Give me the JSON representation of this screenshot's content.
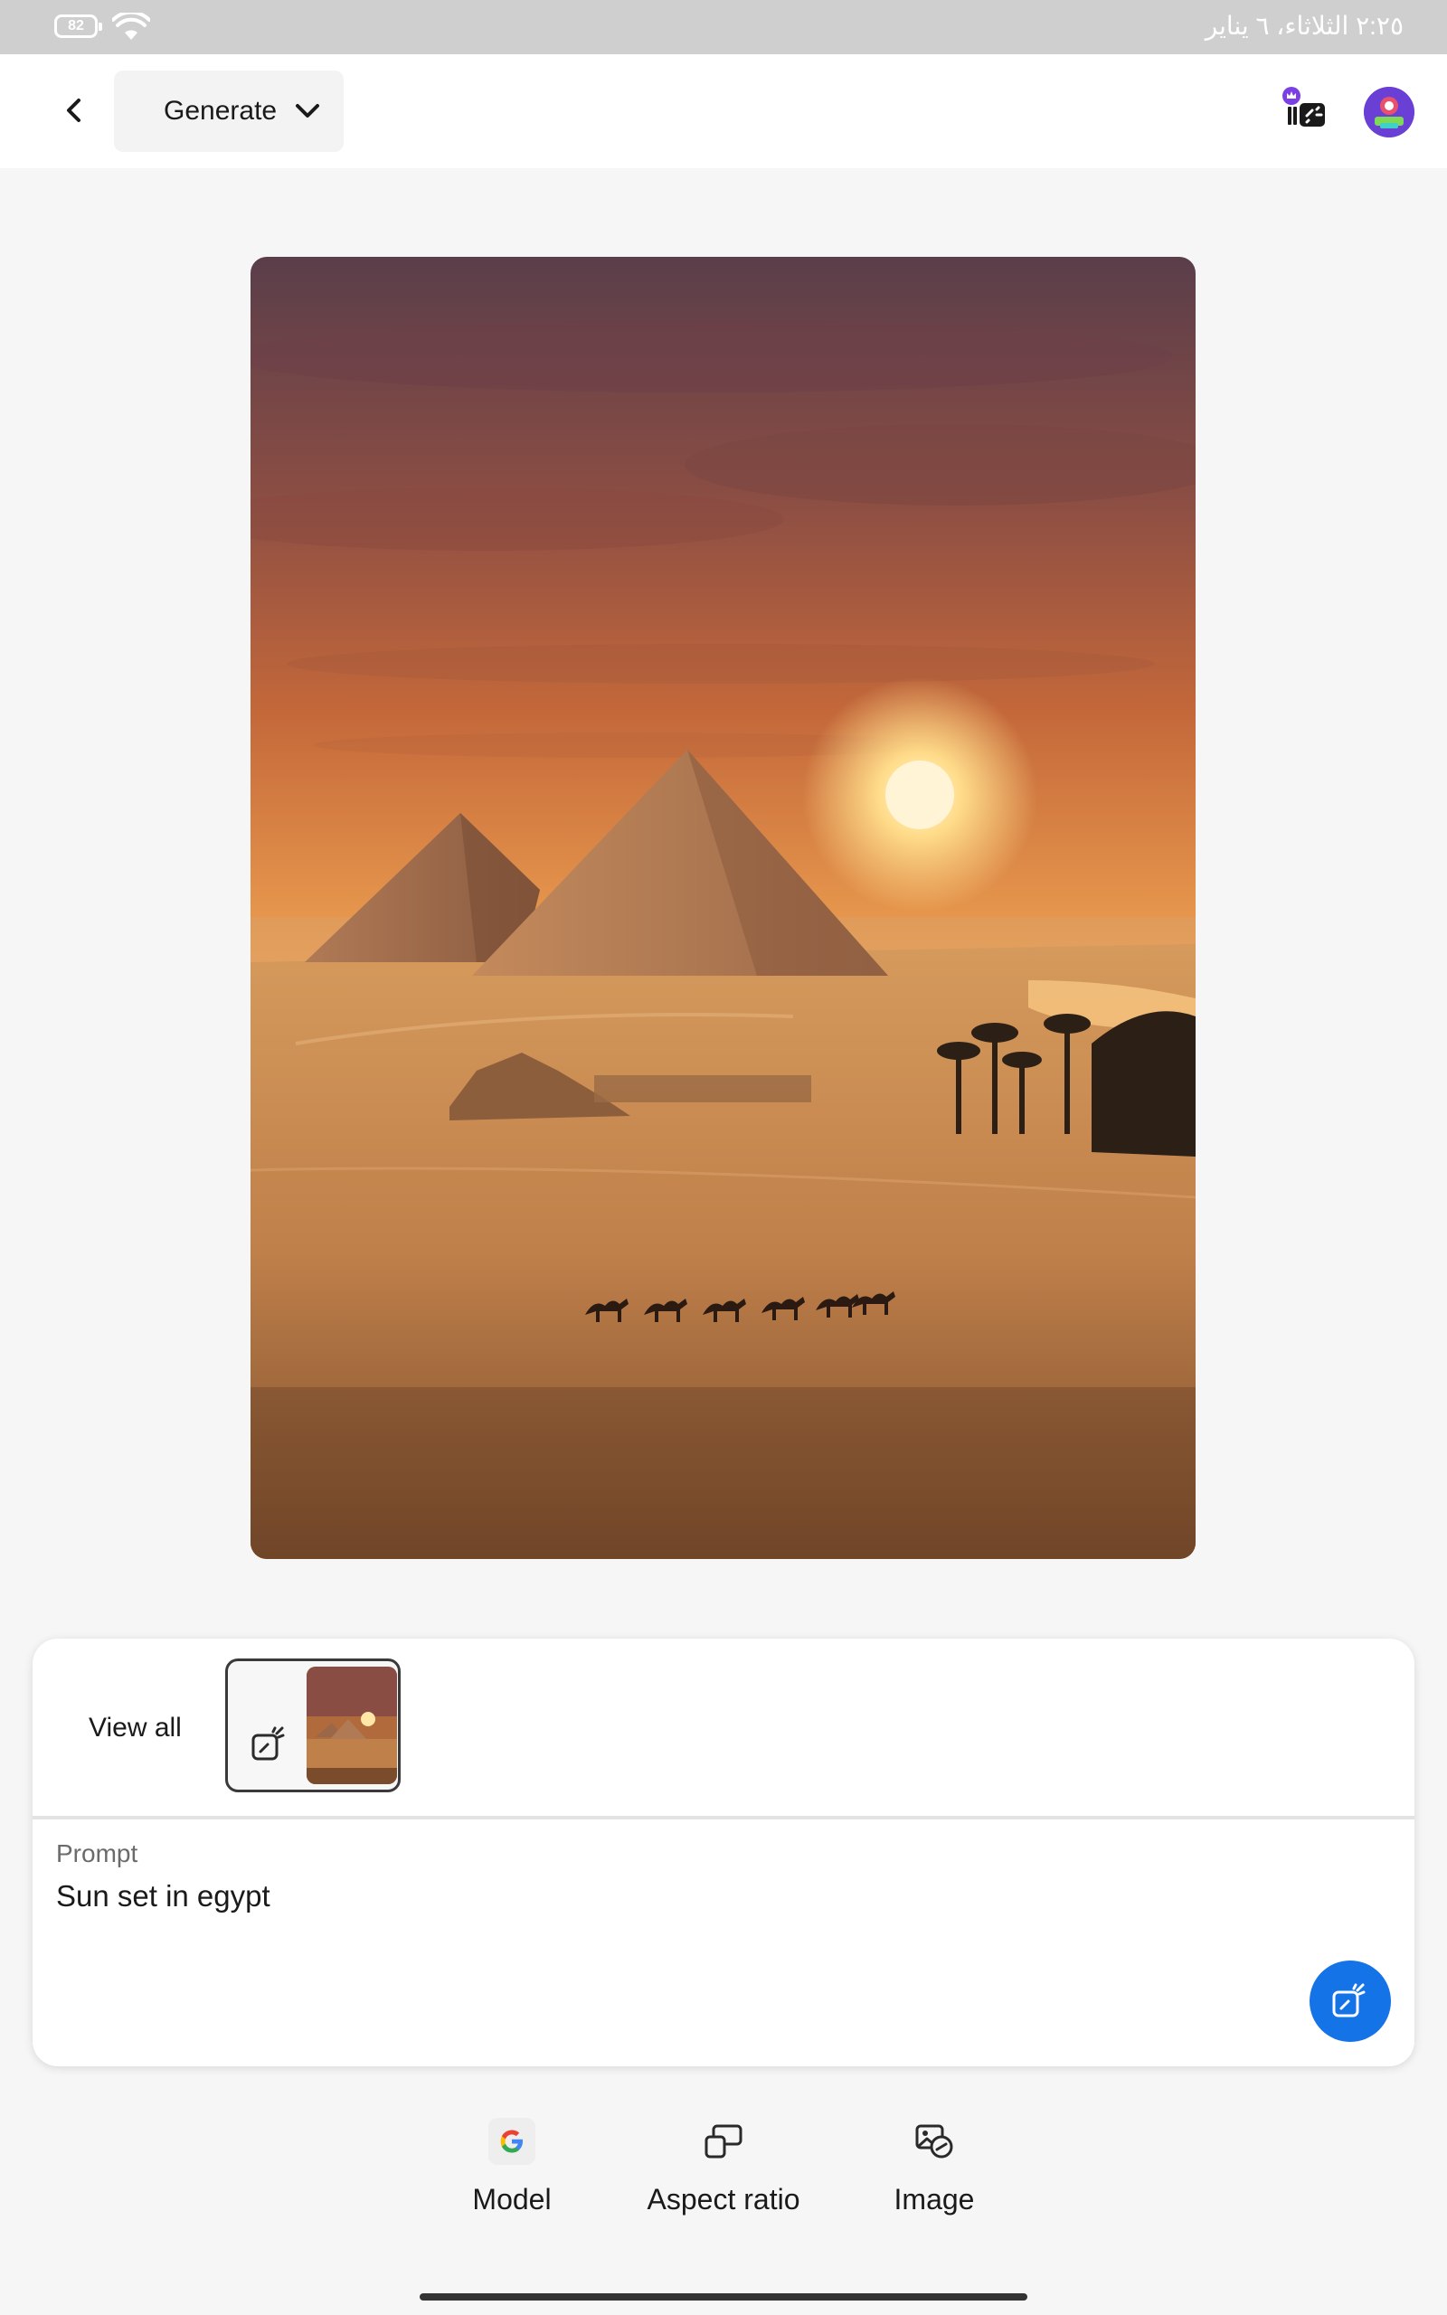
{
  "status_bar": {
    "battery_level": "82",
    "datetime": "٢:٢٥  الثلاثاء، ٦ يناير"
  },
  "header": {
    "mode_label": "Generate"
  },
  "panel": {
    "view_all_label": "View all",
    "prompt_label": "Prompt",
    "prompt_text": "Sun set in egypt"
  },
  "toolbar": {
    "model_label": "Model",
    "aspect_ratio_label": "Aspect ratio",
    "image_label": "Image"
  },
  "colors": {
    "accent": "#1473e6",
    "avatar": "#6a3fd6"
  },
  "icons": [
    "back-icon",
    "chevron-down-icon",
    "credits-icon",
    "avatar",
    "sparkle-edit-icon",
    "google-icon",
    "aspect-ratio-icon",
    "image-reference-icon",
    "wifi-icon",
    "battery-icon"
  ]
}
